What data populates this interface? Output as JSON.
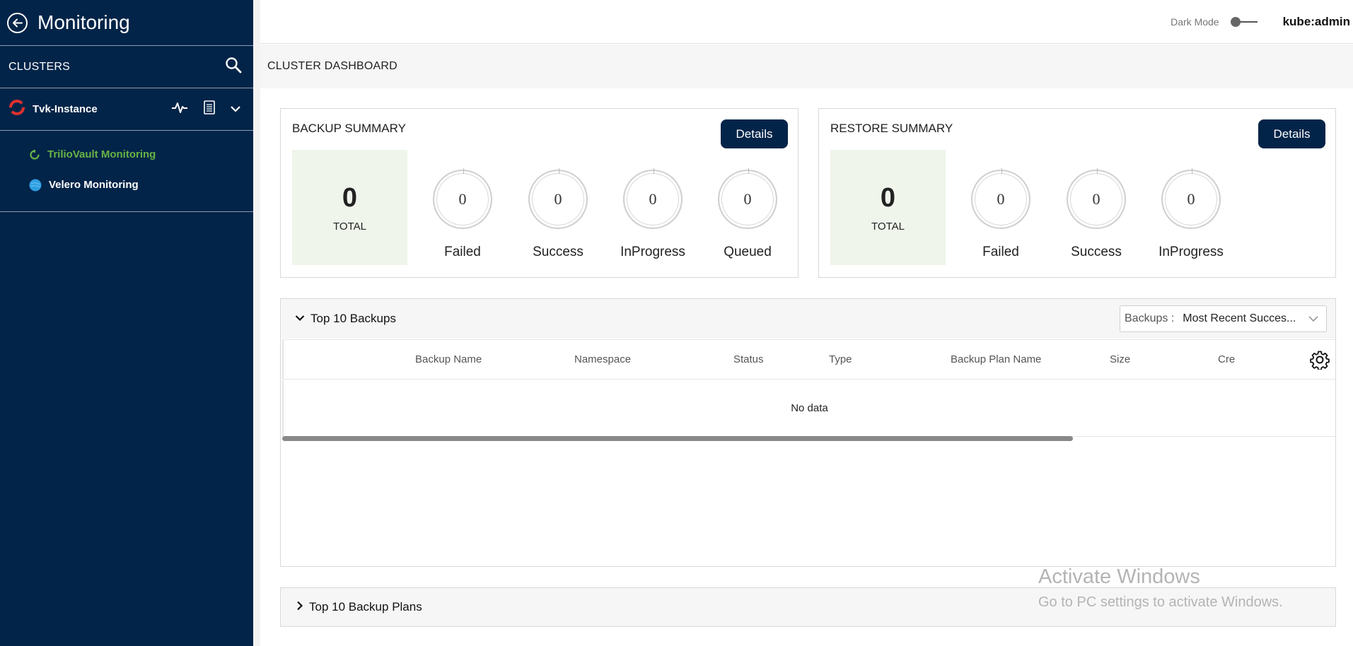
{
  "sidebar": {
    "title": "Monitoring",
    "clusters_label": "CLUSTERS",
    "instance_name": "Tvk-Instance",
    "sub_items": [
      {
        "label": "TrilioVault Monitoring",
        "active": true
      },
      {
        "label": "Velero Monitoring",
        "active": false
      }
    ]
  },
  "topbar": {
    "dark_mode_label": "Dark Mode",
    "user": "kube:admin"
  },
  "dashboard_title": "CLUSTER DASHBOARD",
  "backup_summary": {
    "title": "BACKUP SUMMARY",
    "details_label": "Details",
    "total": "0",
    "total_label": "TOTAL",
    "stats": [
      {
        "label": "Failed",
        "value": "0"
      },
      {
        "label": "Success",
        "value": "0"
      },
      {
        "label": "InProgress",
        "value": "0"
      },
      {
        "label": "Queued",
        "value": "0"
      }
    ]
  },
  "restore_summary": {
    "title": "RESTORE SUMMARY",
    "details_label": "Details",
    "total": "0",
    "total_label": "TOTAL",
    "stats": [
      {
        "label": "Failed",
        "value": "0"
      },
      {
        "label": "Success",
        "value": "0"
      },
      {
        "label": "InProgress",
        "value": "0"
      }
    ]
  },
  "top_backups": {
    "title": "Top 10 Backups",
    "filter_label": "Backups :",
    "filter_value": "Most Recent Succes...",
    "columns": [
      "Backup Name",
      "Namespace",
      "Status",
      "Type",
      "Backup Plan Name",
      "Size",
      "Cre"
    ],
    "empty_text": "No data"
  },
  "top_backup_plans": {
    "title": "Top 10 Backup Plans"
  },
  "watermark": {
    "line1": "Activate Windows",
    "line2": "Go to PC settings to activate Windows."
  },
  "colors": {
    "sidebar_bg": "#022448",
    "accent_green": "#67b346",
    "button_bg": "#022448",
    "total_bg": "#eff5eb"
  }
}
